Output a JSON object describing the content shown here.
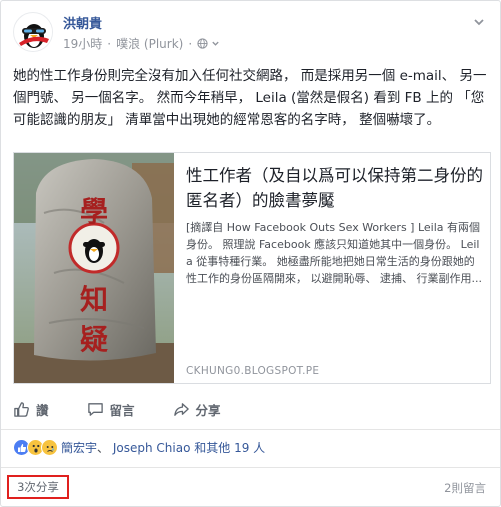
{
  "author": {
    "name": "洪朝貴"
  },
  "meta": {
    "time": "19小時",
    "separator": "·",
    "source": "噗浪 (Plurk)",
    "audience_icon": "globe-icon",
    "menu_icon": "chevron-down-icon"
  },
  "post_text": "她的性工作身份則完全沒有加入任何社交網路， 而是採用另一個 e-mail、 另一個門號、 另一個名字。 然而今年稍早， Leila (當然是假名) 看到 FB 上的 「您可能認識的朋友」 清單當中出現她的經常恩客的名字時， 整個嚇壞了。",
  "card": {
    "image_text": [
      "學",
      "知",
      "疑"
    ],
    "title": "性工作者（及自以爲可以保持第二身份的匿名者）的臉書夢魘",
    "description": "[摘譯自 How Facebook Outs Sex Workers ] Leila 有兩個身份。 照理說 Facebook 應該只知道她其中一個身份。 Leila 從事特種行業。 她極盡所能地把她日常生活的身份跟她的性工作的身份區隔開來， 以避開恥辱、 逮捕、 行業副作用...",
    "domain": "CKHUNG0.BLOGSPOT.PE"
  },
  "actions": {
    "like": "讚",
    "comment": "留言",
    "share": "分享"
  },
  "reactions": {
    "icons": [
      "like-reaction-icon",
      "wow-reaction-icon",
      "sad-reaction-icon"
    ],
    "name1": "簡宏宇",
    "sep": "、",
    "name2": "Joseph Chiao",
    "others": "和其他 19 人"
  },
  "footer": {
    "shares": "3次分享",
    "comments": "2則留言"
  },
  "colors": {
    "link": "#365899",
    "highlight_box": "#e0201e",
    "like_blue": "#4c7ef3",
    "react_yellow": "#f7c33f"
  }
}
